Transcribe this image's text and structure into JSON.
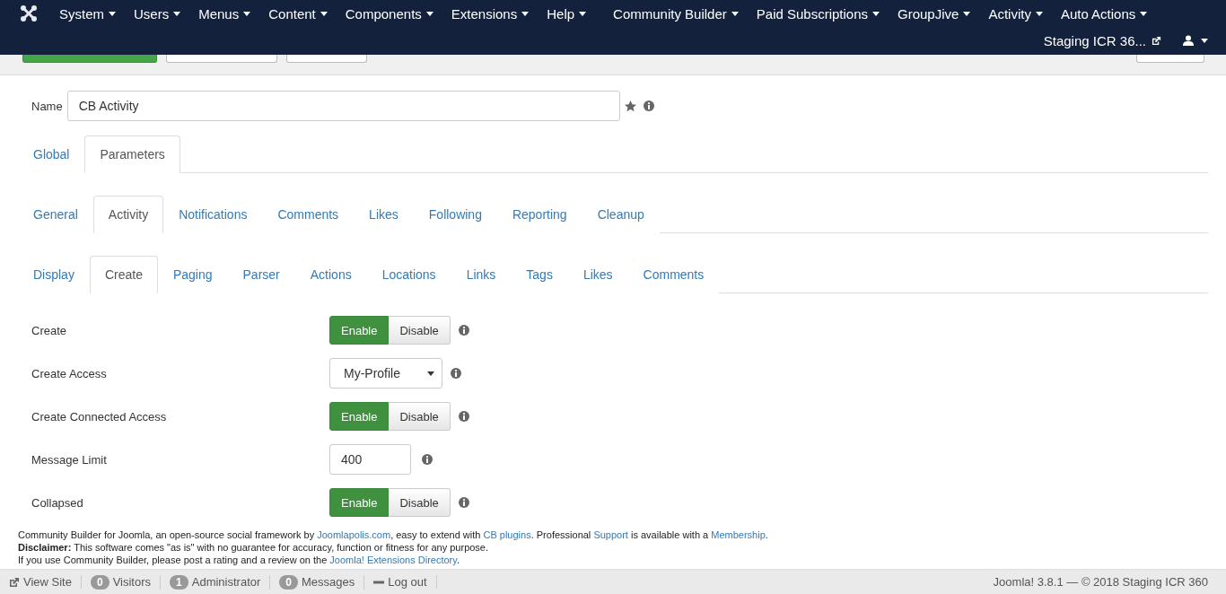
{
  "navbar": {
    "menus": [
      "System",
      "Users",
      "Menus",
      "Content",
      "Components",
      "Extensions",
      "Help",
      "Community Builder",
      "Paid Subscriptions",
      "GroupJive",
      "Activity",
      "Auto Actions"
    ],
    "site_link": "Staging ICR 36..."
  },
  "name_field": {
    "label": "Name",
    "value": "CB Activity"
  },
  "tabs": [
    {
      "label": "Global",
      "selected": false
    },
    {
      "label": "Parameters",
      "selected": true
    }
  ],
  "subtabs": [
    {
      "label": "General",
      "selected": false
    },
    {
      "label": "Activity",
      "selected": true
    },
    {
      "label": "Notifications",
      "selected": false
    },
    {
      "label": "Comments",
      "selected": false
    },
    {
      "label": "Likes",
      "selected": false
    },
    {
      "label": "Following",
      "selected": false
    },
    {
      "label": "Reporting",
      "selected": false
    },
    {
      "label": "Cleanup",
      "selected": false
    }
  ],
  "section_tabs": [
    {
      "label": "Display",
      "selected": false
    },
    {
      "label": "Create",
      "selected": true
    },
    {
      "label": "Paging",
      "selected": false
    },
    {
      "label": "Parser",
      "selected": false
    },
    {
      "label": "Actions",
      "selected": false
    },
    {
      "label": "Locations",
      "selected": false
    },
    {
      "label": "Links",
      "selected": false
    },
    {
      "label": "Tags",
      "selected": false
    },
    {
      "label": "Likes",
      "selected": false
    },
    {
      "label": "Comments",
      "selected": false
    }
  ],
  "fields": [
    {
      "label": "Create",
      "kind": "toggle",
      "options": [
        {
          "label": "Enable",
          "selected": true
        },
        {
          "label": "Disable",
          "selected": false
        }
      ]
    },
    {
      "label": "Create Access",
      "kind": "select",
      "value": "My-Profile"
    },
    {
      "label": "Create Connected Access",
      "kind": "toggle",
      "options": [
        {
          "label": "Enable",
          "selected": true
        },
        {
          "label": "Disable",
          "selected": false
        }
      ]
    },
    {
      "label": "Message Limit",
      "kind": "text",
      "value": "400"
    },
    {
      "label": "Collapsed",
      "kind": "toggle",
      "options": [
        {
          "label": "Enable",
          "selected": true
        },
        {
          "label": "Disable",
          "selected": false
        }
      ]
    }
  ],
  "footer": [
    [
      {
        "kind": "text",
        "text": "Community Builder for Joomla, an open-source social framework by "
      },
      {
        "kind": "link",
        "text": "Joomlapolis.com"
      },
      {
        "kind": "text",
        "text": ", easy to extend with "
      },
      {
        "kind": "link",
        "text": "CB plugins"
      },
      {
        "kind": "text",
        "text": ". Professional "
      },
      {
        "kind": "link",
        "text": "Support"
      },
      {
        "kind": "text",
        "text": " is available with a "
      },
      {
        "kind": "link",
        "text": "Membership"
      },
      {
        "kind": "text",
        "text": "."
      }
    ],
    [
      {
        "kind": "text",
        "text": "**Disclaimer:** This software comes \"as is\" with no guarantee for accuracy, function or fitness for any purpose."
      }
    ],
    [
      {
        "kind": "text",
        "text": "If you use Community Builder, please post a rating and a review on the "
      },
      {
        "kind": "link",
        "text": "Joomla! Extensions Directory"
      },
      {
        "kind": "text",
        "text": "."
      }
    ]
  ],
  "status_bar": {
    "items": [
      {
        "kind": "link",
        "label": "View Site"
      },
      {
        "kind": "count",
        "count": "0",
        "label": "Visitors"
      },
      {
        "kind": "count",
        "count": "1",
        "label": "Administrator"
      },
      {
        "kind": "count",
        "count": "0",
        "label": "Messages"
      },
      {
        "kind": "logout",
        "label": "Log out"
      }
    ],
    "version": "Joomla! 3.8.1 — © 2018 Staging ICR 360"
  }
}
